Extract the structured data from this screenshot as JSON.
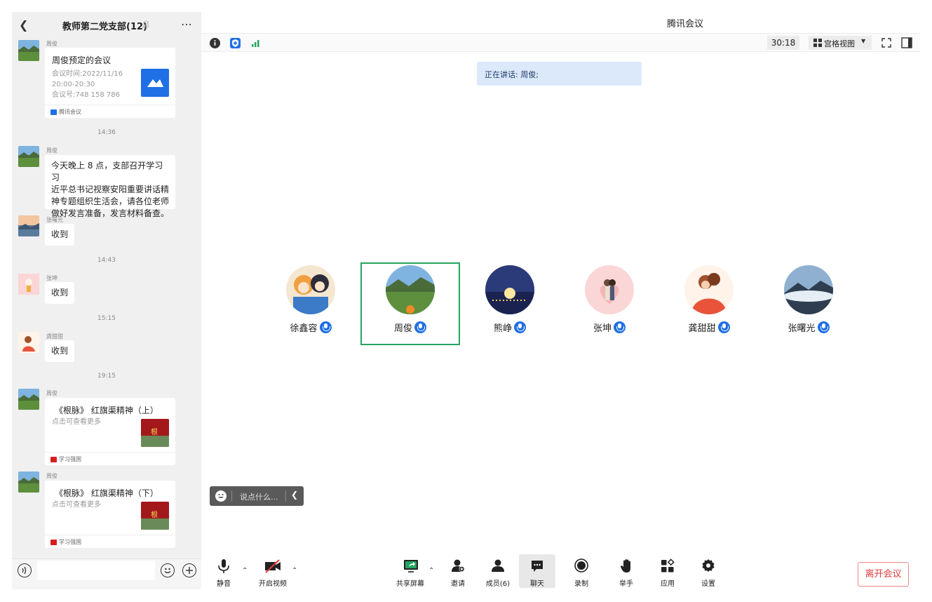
{
  "window": {
    "title": "腾讯会议"
  },
  "chat": {
    "title": "教师第二党支部(12)",
    "messages": [
      {
        "type": "card",
        "sender": "周俊",
        "title": "周俊预定的会议",
        "lines": [
          "会议时间:2022/11/16",
          "20:00-20:30",
          "会议号:748 158 786"
        ],
        "source": "腾讯会议"
      },
      {
        "type": "time",
        "text": "14:36"
      },
      {
        "type": "text",
        "sender": "周俊",
        "lines": [
          "今天晚上 8 点，支部召开学习习",
          "近平总书记视察安阳重要讲话精",
          "神专题组织生活会，请各位老师",
          "做好发言准备，发言材料备查。"
        ]
      },
      {
        "type": "text",
        "sender": "张曙光",
        "lines": [
          "收到"
        ]
      },
      {
        "type": "time",
        "text": "14:43"
      },
      {
        "type": "text",
        "sender": "张坤",
        "lines": [
          "收到"
        ]
      },
      {
        "type": "time",
        "text": "15:15"
      },
      {
        "type": "text",
        "sender": "龚甜甜",
        "lines": [
          "收到"
        ]
      },
      {
        "type": "time",
        "text": "19:15"
      },
      {
        "type": "card",
        "sender": "周俊",
        "title": "《根脉》 红旗渠精神（上）",
        "lines": [
          "点击可查看更多"
        ],
        "source": "学习强国"
      },
      {
        "type": "card",
        "sender": "周俊",
        "title": "《根脉》 红旗渠精神（下）",
        "lines": [
          "点击可查看更多"
        ],
        "source": "学习强国"
      }
    ],
    "input": {
      "value": "",
      "placeholder": ""
    },
    "colors": {
      "tencent": "#1f6fe5",
      "xuexi": "#d71f1f"
    }
  },
  "meeting": {
    "timer": "30:18",
    "view_mode": "宫格视图",
    "speaking": "正在讲话: 周俊;",
    "quick_chat_placeholder": "说点什么...",
    "participants": [
      {
        "name": "徐鑫容",
        "avatar": "anime-friends",
        "active": false
      },
      {
        "name": "周俊",
        "avatar": "mountain-meadow",
        "active": true
      },
      {
        "name": "熊峥",
        "avatar": "night-lights",
        "active": false
      },
      {
        "name": "张坤",
        "avatar": "pink-couple",
        "active": false
      },
      {
        "name": "龚甜甜",
        "avatar": "hug-couple",
        "active": false
      },
      {
        "name": "张曙光",
        "avatar": "sea-of-clouds",
        "active": false
      }
    ],
    "toolbar": {
      "mute": "静音",
      "video": "开启视频",
      "share": "共享屏幕",
      "invite": "邀请",
      "members": "成员(6)",
      "chat": "聊天",
      "record": "录制",
      "raise_hand": "举手",
      "apps": "应用",
      "settings": "设置",
      "leave": "离开会议"
    },
    "colors": {
      "active_border": "#25a55f",
      "mic_blue": "#1f6fe5",
      "leave_red": "#e03a3a",
      "banner": "#dbe9fb"
    }
  }
}
